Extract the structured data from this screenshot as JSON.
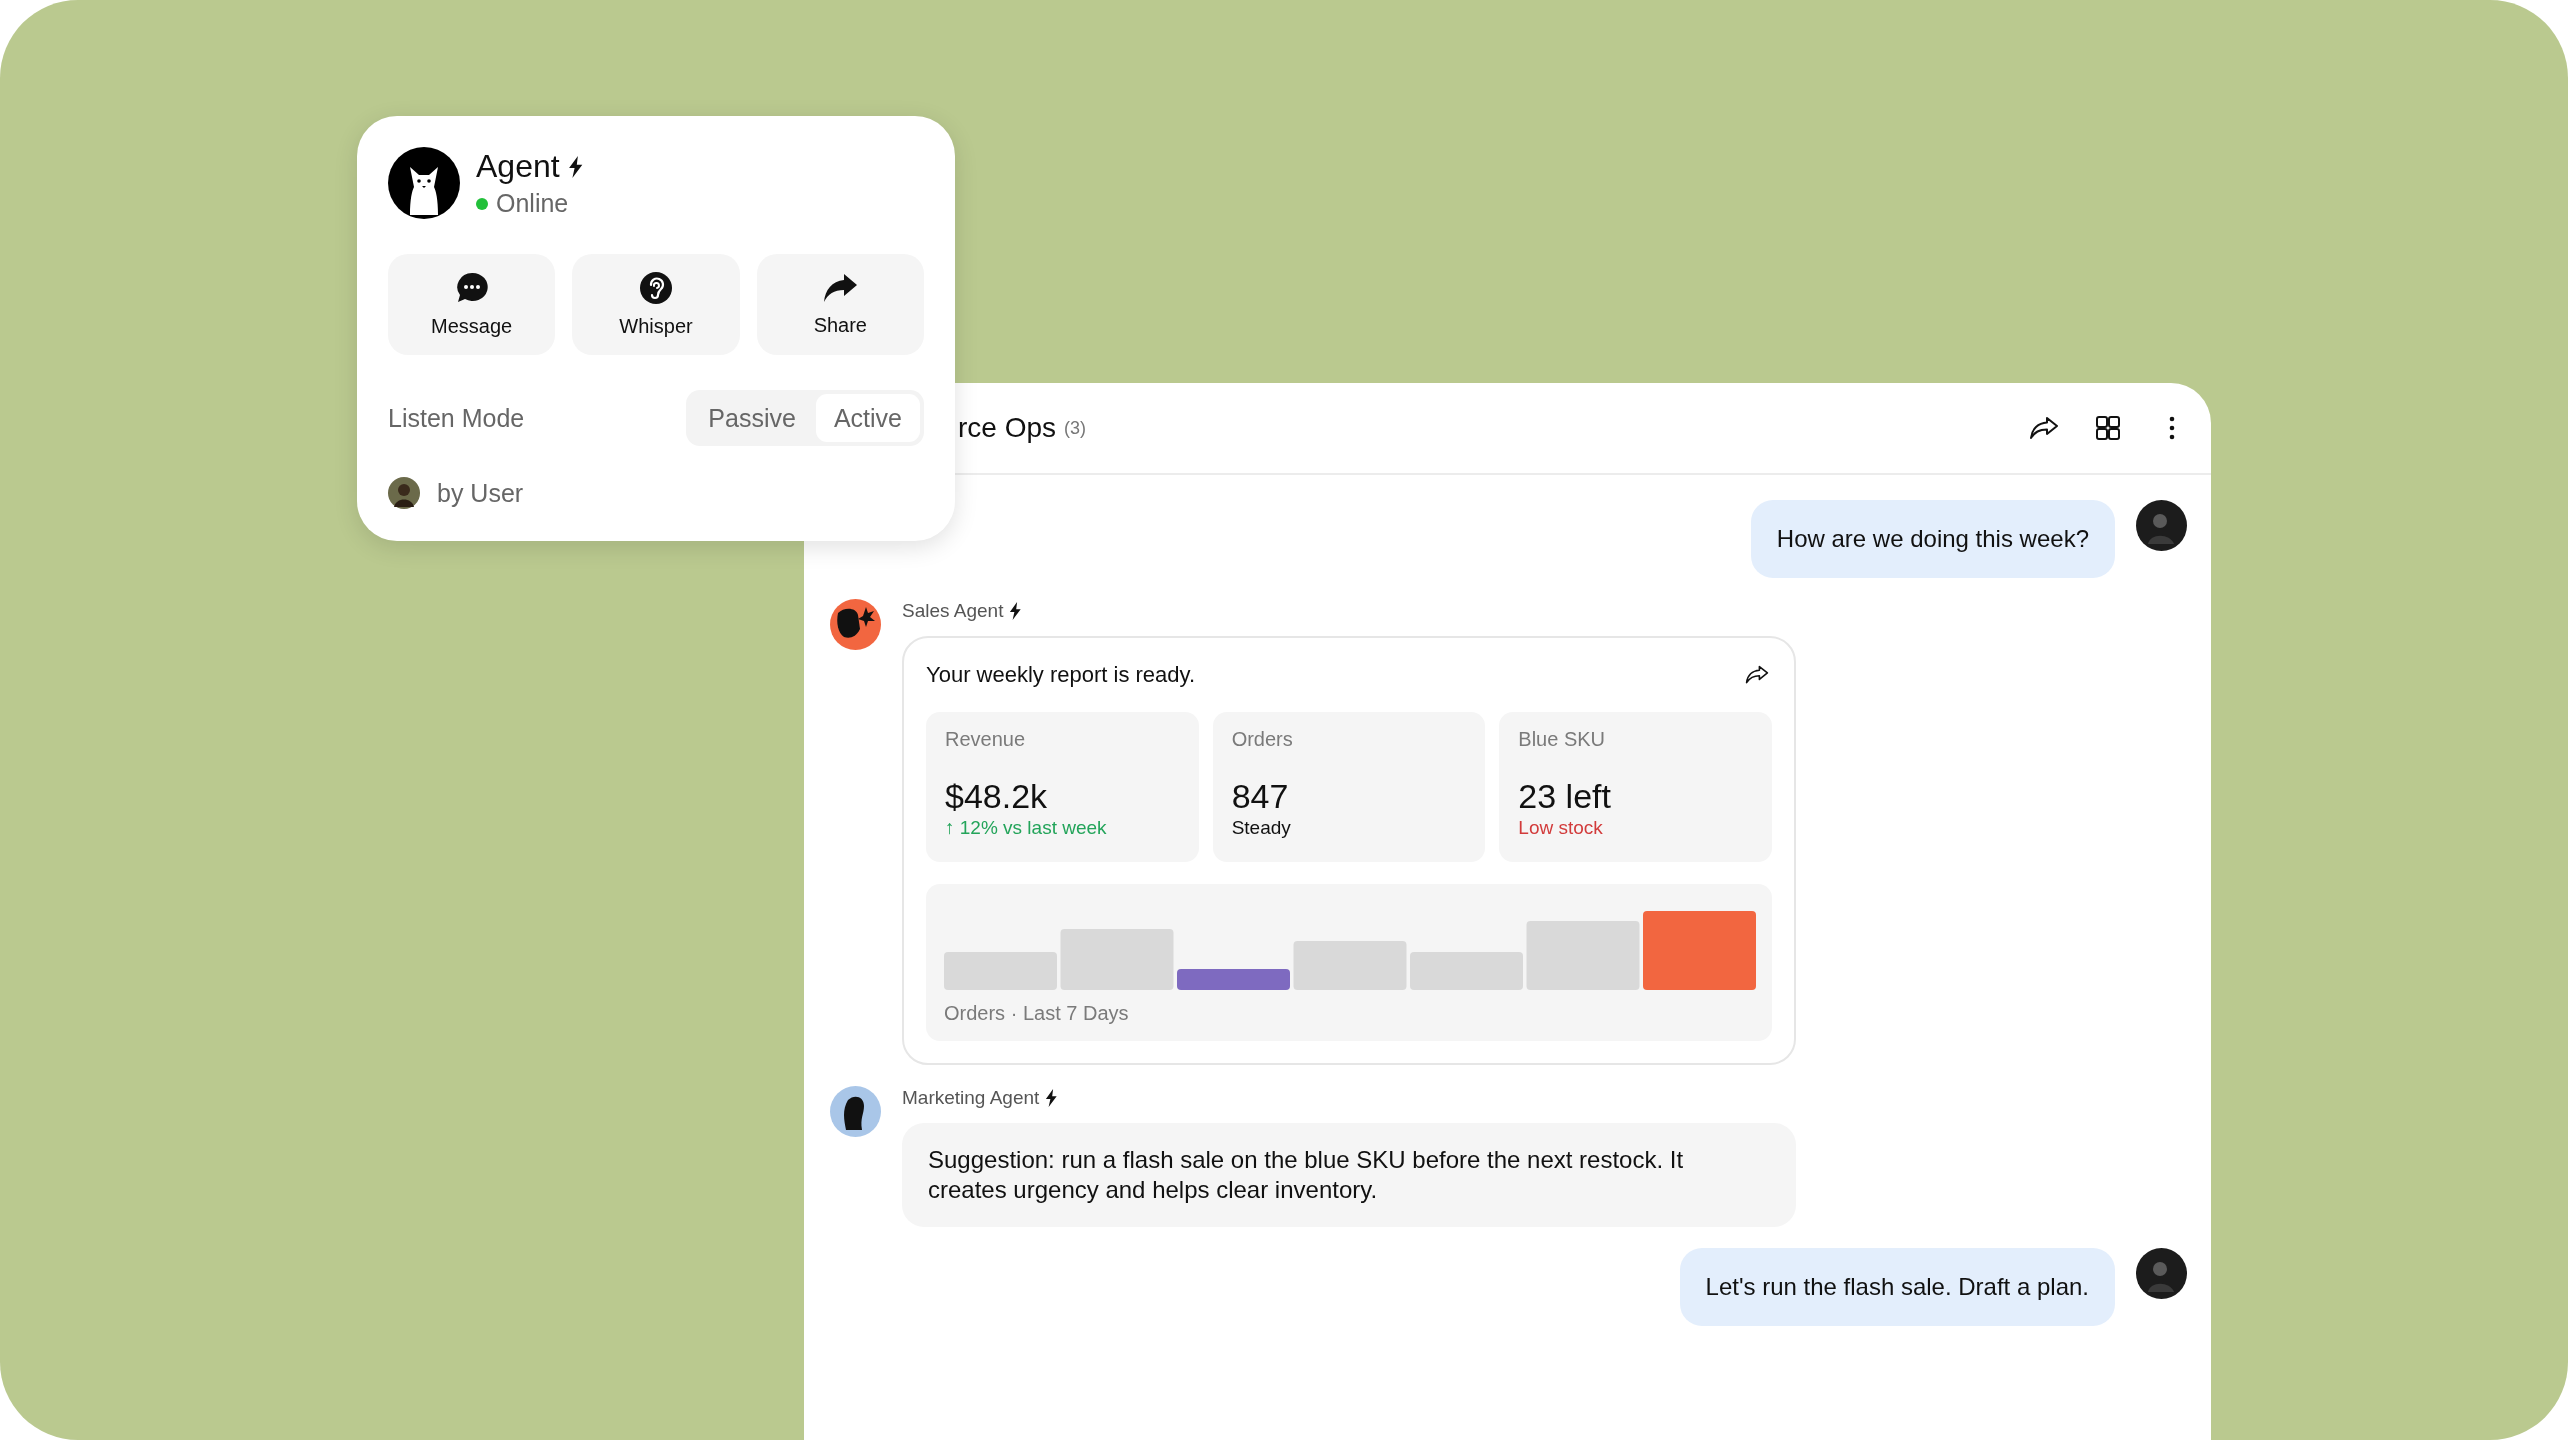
{
  "agent_card": {
    "name": "Agent",
    "status": "Online",
    "online": true,
    "actions": [
      {
        "kind": "message",
        "label": "Message"
      },
      {
        "kind": "whisper",
        "label": "Whisper"
      },
      {
        "kind": "share",
        "label": "Share"
      }
    ],
    "listen_mode": {
      "label": "Listen Mode",
      "options": [
        {
          "label": "Passive",
          "selected": false
        },
        {
          "label": "Active",
          "selected": true
        }
      ]
    },
    "owner": "by User"
  },
  "chat": {
    "title": "rce Ops",
    "count": "(3)",
    "messages": [
      {
        "kind": "user",
        "text": "How are we doing this week?"
      },
      {
        "kind": "report",
        "sender": "Sales Agent",
        "color": "#f26640",
        "text": "Your weekly report is ready.",
        "stats": [
          {
            "label": "Revenue",
            "value": "$48.2k",
            "note": "↑ 12% vs last week",
            "kind": "up"
          },
          {
            "label": "Orders",
            "value": "847",
            "note": "Steady",
            "kind": "flat"
          },
          {
            "label": "Blue SKU",
            "value": "23 left",
            "note": "Low stock",
            "kind": "down"
          }
        ],
        "chart_caption": "Orders · Last 7 Days"
      },
      {
        "kind": "text",
        "sender": "Marketing Agent",
        "color": "#a9c6e8",
        "text": "Suggestion: run a flash sale on the blue SKU before the next restock. It creates urgency and helps clear inventory."
      },
      {
        "kind": "user",
        "text": "Let's run the flash sale. Draft a plan."
      }
    ]
  }
}
